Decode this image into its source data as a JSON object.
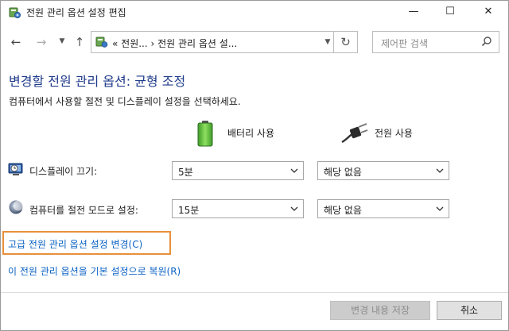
{
  "window": {
    "title": "전원 관리 옵션 설정 편집",
    "minimize_glyph": "—",
    "maximize_glyph": "☐",
    "close_glyph": "✕"
  },
  "nav": {
    "back_glyph": "←",
    "forward_glyph": "→",
    "recent_glyph": "▼",
    "up_glyph": "↑",
    "address": "« 전원...  ›  전원 관리 옵션 설...",
    "address_dropdown_glyph": "▼",
    "refresh_glyph": "↻",
    "search_placeholder": "제어판 검색"
  },
  "content": {
    "heading": "변경할 전원 관리 옵션: 균형 조정",
    "subtitle": "컴퓨터에서 사용할 절전 및 디스플레이 설정을 선택하세요.",
    "columns": {
      "battery": "배터리 사용",
      "plugged": "전원 사용"
    },
    "rows": [
      {
        "label": "디스플레이 끄기:",
        "battery": "5분",
        "plugged": "해당 없음"
      },
      {
        "label": "컴퓨터를 절전 모드로 설정:",
        "battery": "15분",
        "plugged": "해당 없음"
      }
    ],
    "links": {
      "advanced": "고급 전원 관리 옵션 설정 변경(C)",
      "restore": "이 전원 관리 옵션을 기본 설정으로 복원(R)"
    }
  },
  "footer": {
    "save": "변경 내용 저장",
    "cancel": "취소"
  },
  "colors": {
    "heading": "#1e3a8a",
    "link": "#0b62c4",
    "highlight": "#e8903c",
    "battery_green": "#5fbf3a"
  }
}
